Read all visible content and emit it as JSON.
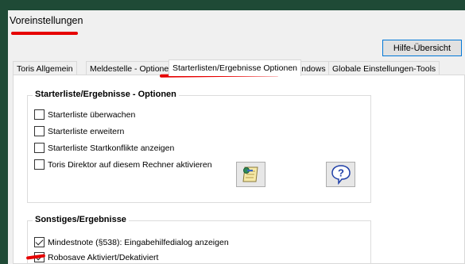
{
  "window": {
    "title": "Voreinstellungen"
  },
  "toolbar": {
    "help_label": "Hilfe-Übersicht"
  },
  "tabs": [
    {
      "label": "Toris Allgemein"
    },
    {
      "label": "Meldestelle - Optionen"
    },
    {
      "label": "Starterlisten/Ergebnisse Optionen",
      "active": true
    },
    {
      "label": "Windows"
    },
    {
      "label": "Globale Einstellungen-Tools"
    }
  ],
  "group1": {
    "title": "Starterliste/Ergebnisse - Optionen",
    "checkboxes": [
      {
        "label": "Starterliste überwachen",
        "checked": false
      },
      {
        "label": "Starterliste erweitern",
        "checked": false
      },
      {
        "label": "Starterliste Startkonflikte anzeigen",
        "checked": false
      },
      {
        "label": "Toris Direktor auf diesem Rechner aktivieren",
        "checked": false
      }
    ],
    "buttons": [
      {
        "icon": "notes-icon"
      },
      {
        "icon": "help-question-icon"
      }
    ]
  },
  "group2": {
    "title": "Sonstiges/Ergebnisse",
    "checkboxes": [
      {
        "label": "Mindestnote (§538): Eingabehilfedialog anzeigen",
        "checked": true
      },
      {
        "label": "Robosave Aktiviert/Dekativiert",
        "checked": true
      }
    ]
  },
  "annotation_color": "#e60000"
}
